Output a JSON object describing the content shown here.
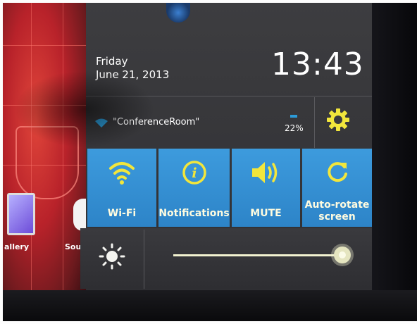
{
  "home": {
    "app1_label": "allery",
    "app2_label": "Sour"
  },
  "header": {
    "day": "Friday",
    "date": "June 21, 2013",
    "time": "13:43"
  },
  "wifi_status": {
    "network": "\"ConferenceRoom\"",
    "battery": "22%"
  },
  "toggles": [
    {
      "label": "Wi-Fi",
      "icon": "wifi-icon"
    },
    {
      "label": "Notifications",
      "icon": "info-icon"
    },
    {
      "label": "MUTE",
      "icon": "speaker-icon"
    },
    {
      "label": "Auto-rotate screen",
      "icon": "rotate-icon"
    }
  ],
  "brightness": {
    "level": 1.0,
    "icon": "sun-icon"
  },
  "colors": {
    "tile_blue": "#3d9bdd",
    "icon_yellow": "#f2e63c",
    "panel_bg": "#3d3d40"
  }
}
